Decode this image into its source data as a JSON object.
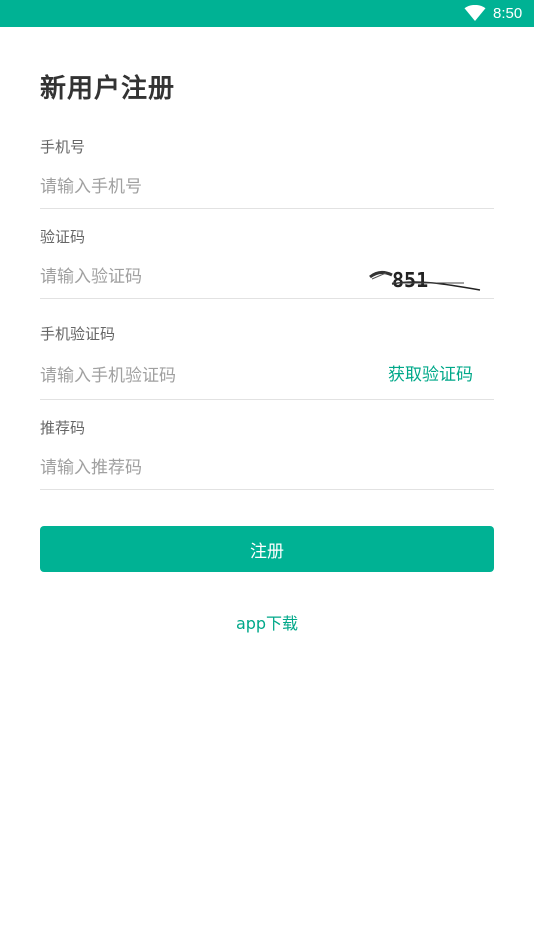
{
  "status_bar": {
    "time": "8:50",
    "wifi_icon": "wifi-icon",
    "color": "#00b294"
  },
  "page": {
    "title": "新用户注册"
  },
  "form": {
    "phone": {
      "label": "手机号",
      "placeholder": "请输入手机号"
    },
    "captcha": {
      "label": "验证码",
      "placeholder": "请输入验证码",
      "image_text": "851"
    },
    "sms_code": {
      "label": "手机验证码",
      "placeholder": "请输入手机验证码",
      "get_code_label": "获取验证码"
    },
    "referral": {
      "label": "推荐码",
      "placeholder": "请输入推荐码"
    },
    "submit_label": "注册"
  },
  "footer": {
    "app_download": "app下载"
  },
  "colors": {
    "accent": "#00b294",
    "link": "#00a889"
  }
}
